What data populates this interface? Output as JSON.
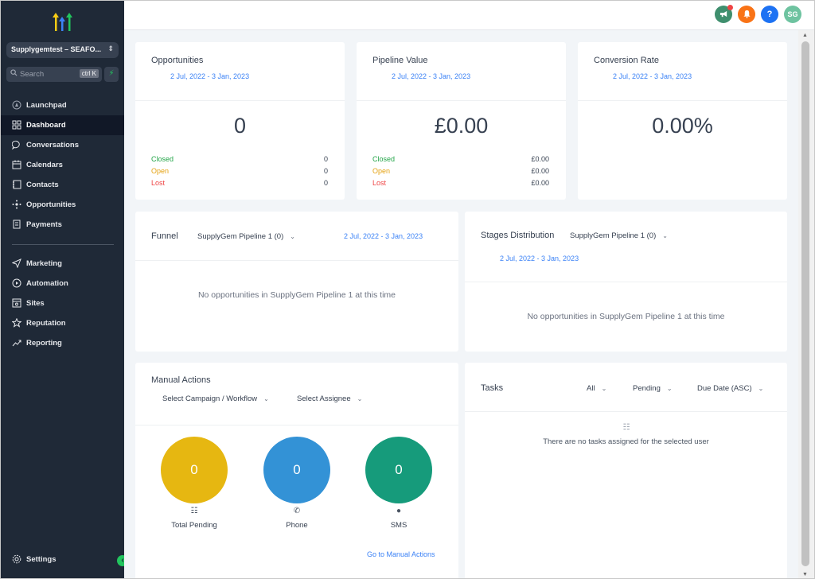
{
  "sidebar": {
    "location": "Supplygemtest – SEAFO...",
    "search_placeholder": "Search",
    "search_shortcut": "ctrl K",
    "nav": [
      {
        "label": "Launchpad",
        "icon": "rocket-icon"
      },
      {
        "label": "Dashboard",
        "icon": "dashboard-grid-icon",
        "active": true
      },
      {
        "label": "Conversations",
        "icon": "chat-bubble-icon"
      },
      {
        "label": "Calendars",
        "icon": "calendar-icon"
      },
      {
        "label": "Contacts",
        "icon": "contacts-icon"
      },
      {
        "label": "Opportunities",
        "icon": "opportunities-icon"
      },
      {
        "label": "Payments",
        "icon": "payments-icon"
      }
    ],
    "nav2": [
      {
        "label": "Marketing",
        "icon": "send-icon"
      },
      {
        "label": "Automation",
        "icon": "automation-icon"
      },
      {
        "label": "Sites",
        "icon": "sites-icon"
      },
      {
        "label": "Reputation",
        "icon": "star-icon"
      },
      {
        "label": "Reporting",
        "icon": "trend-icon"
      }
    ],
    "settings_label": "Settings"
  },
  "header": {
    "avatar_initials": "SG",
    "colors": {
      "announce": "#3f8f6e",
      "bell": "#f97316",
      "help": "#1d72f3",
      "avatar": "#6ec3a0"
    }
  },
  "cards": {
    "opportunities": {
      "title": "Opportunities",
      "date_range": "2 Jul, 2022 - 3 Jan, 2023",
      "value": "0",
      "stats": [
        {
          "label": "Closed",
          "value": "0"
        },
        {
          "label": "Open",
          "value": "0"
        },
        {
          "label": "Lost",
          "value": "0"
        }
      ]
    },
    "pipeline_value": {
      "title": "Pipeline Value",
      "date_range": "2 Jul, 2022 - 3 Jan, 2023",
      "value": "£0.00",
      "stats": [
        {
          "label": "Closed",
          "value": "£0.00"
        },
        {
          "label": "Open",
          "value": "£0.00"
        },
        {
          "label": "Lost",
          "value": "£0.00"
        }
      ]
    },
    "conversion_rate": {
      "title": "Conversion Rate",
      "date_range": "2 Jul, 2022 - 3 Jan, 2023",
      "value": "0.00%"
    },
    "funnel": {
      "title": "Funnel",
      "pipeline": "SupplyGem Pipeline 1 (0)",
      "date_range": "2 Jul, 2022 - 3 Jan, 2023",
      "empty": "No opportunities in SupplyGem Pipeline 1 at this time"
    },
    "stages": {
      "title": "Stages Distribution",
      "pipeline": "SupplyGem Pipeline 1 (0)",
      "date_range": "2 Jul, 2022 - 3 Jan, 2023",
      "empty": "No opportunities in SupplyGem Pipeline 1 at this time"
    },
    "manual_actions": {
      "title": "Manual Actions",
      "campaign_dd": "Select Campaign / Workflow",
      "assignee_dd": "Select Assignee",
      "items": [
        {
          "label": "Total Pending",
          "value": "0",
          "color": "#e6b711"
        },
        {
          "label": "Phone",
          "value": "0",
          "color": "#3392d6"
        },
        {
          "label": "SMS",
          "value": "0",
          "color": "#169b7b"
        }
      ],
      "link": "Go to Manual Actions"
    },
    "tasks": {
      "title": "Tasks",
      "filter_all": "All",
      "filter_status": "Pending",
      "filter_sort": "Due Date (ASC)",
      "empty": "There are no tasks assigned for the selected user"
    }
  },
  "colors": {
    "closed": "#22a447",
    "open": "#e4a10f",
    "lost": "#ef4444",
    "link": "#3b82f6"
  }
}
